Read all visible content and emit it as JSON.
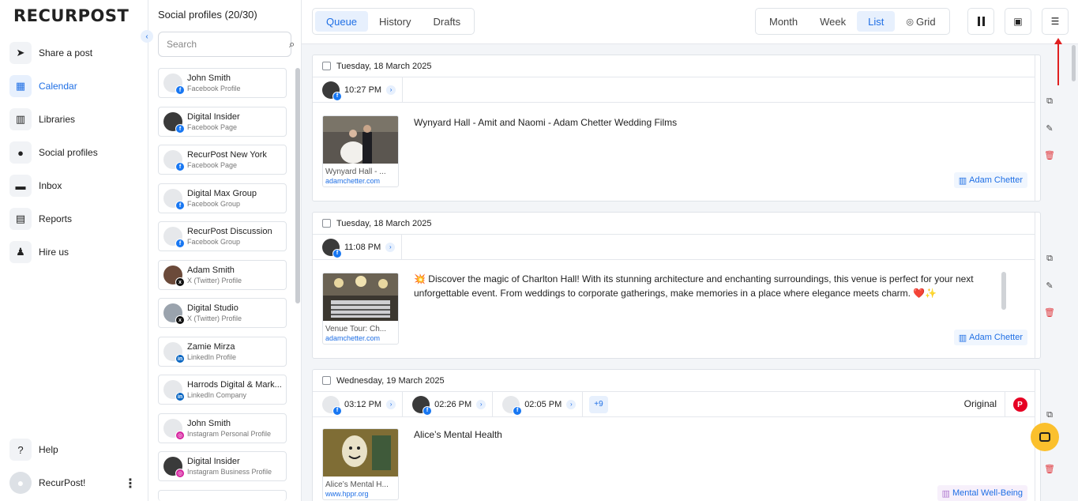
{
  "brand": {
    "logo_text": "RECURPOST"
  },
  "nav": {
    "items": [
      {
        "label": "Share a post",
        "icon": "send-icon"
      },
      {
        "label": "Calendar",
        "icon": "calendar-icon",
        "active": true
      },
      {
        "label": "Libraries",
        "icon": "library-icon"
      },
      {
        "label": "Social profiles",
        "icon": "user-circle-icon"
      },
      {
        "label": "Inbox",
        "icon": "inbox-icon"
      },
      {
        "label": "Reports",
        "icon": "report-icon"
      },
      {
        "label": "Hire us",
        "icon": "person-icon"
      }
    ],
    "help_label": "Help",
    "user_name": "RecurPost!"
  },
  "profiles": {
    "title": "Social profiles (20/30)",
    "search_placeholder": "Search",
    "items": [
      {
        "name": "John Smith",
        "type": "Facebook Profile",
        "network": "fb"
      },
      {
        "name": "Digital Insider",
        "type": "Facebook Page",
        "network": "fb"
      },
      {
        "name": "RecurPost New York",
        "type": "Facebook Page",
        "network": "fb"
      },
      {
        "name": "Digital Max Group",
        "type": "Facebook Group",
        "network": "fb"
      },
      {
        "name": "RecurPost Discussion",
        "type": "Facebook Group",
        "network": "fb"
      },
      {
        "name": "Adam Smith",
        "type": "X (Twitter) Profile",
        "network": "x"
      },
      {
        "name": "Digital Studio",
        "type": "X (Twitter) Profile",
        "network": "x"
      },
      {
        "name": "Zamie Mirza",
        "type": "LinkedIn Profile",
        "network": "li"
      },
      {
        "name": "Harrods Digital & Mark...",
        "type": "LinkedIn Company",
        "network": "li"
      },
      {
        "name": "John Smith",
        "type": "Instagram Personal Profile",
        "network": "ig"
      },
      {
        "name": "Digital Insider",
        "type": "Instagram Business Profile",
        "network": "ig"
      }
    ]
  },
  "toolbar": {
    "left_tabs": [
      "Queue",
      "History",
      "Drafts"
    ],
    "active_left": "Queue",
    "view_tabs": [
      "Month",
      "Week",
      "List",
      "Grid"
    ],
    "active_view": "List",
    "accent": "#1f6fe5"
  },
  "posts": [
    {
      "date": "Tuesday, 18 March 2025",
      "times": [
        "10:27 PM"
      ],
      "text": "Wynyard Hall - Amit and Naomi - Adam Chetter Wedding Films",
      "thumb_title": "Wynyard Hall - ...",
      "thumb_link": "adamchetter.com",
      "library": "Adam Chetter"
    },
    {
      "date": "Tuesday, 18 March 2025",
      "times": [
        "11:08 PM"
      ],
      "text": "💥 Discover the magic of Charlton Hall! With its stunning architecture and enchanting surroundings, this venue is perfect for your next unforgettable event. From weddings to corporate gatherings, make memories in a place where elegance meets charm. ❤️✨",
      "thumb_title": "Venue Tour: Ch...",
      "thumb_link": "adamchetter.com",
      "library": "Adam Chetter"
    },
    {
      "date": "Wednesday, 19 March 2025",
      "times": [
        "03:12 PM",
        "02:26 PM",
        "02:05 PM"
      ],
      "more": "+9",
      "original_label": "Original",
      "text": "Alice’s Mental Health",
      "thumb_title": "Alice’s Mental H...",
      "thumb_link": "www.hppr.org",
      "library": "Mental Well-Being"
    }
  ]
}
